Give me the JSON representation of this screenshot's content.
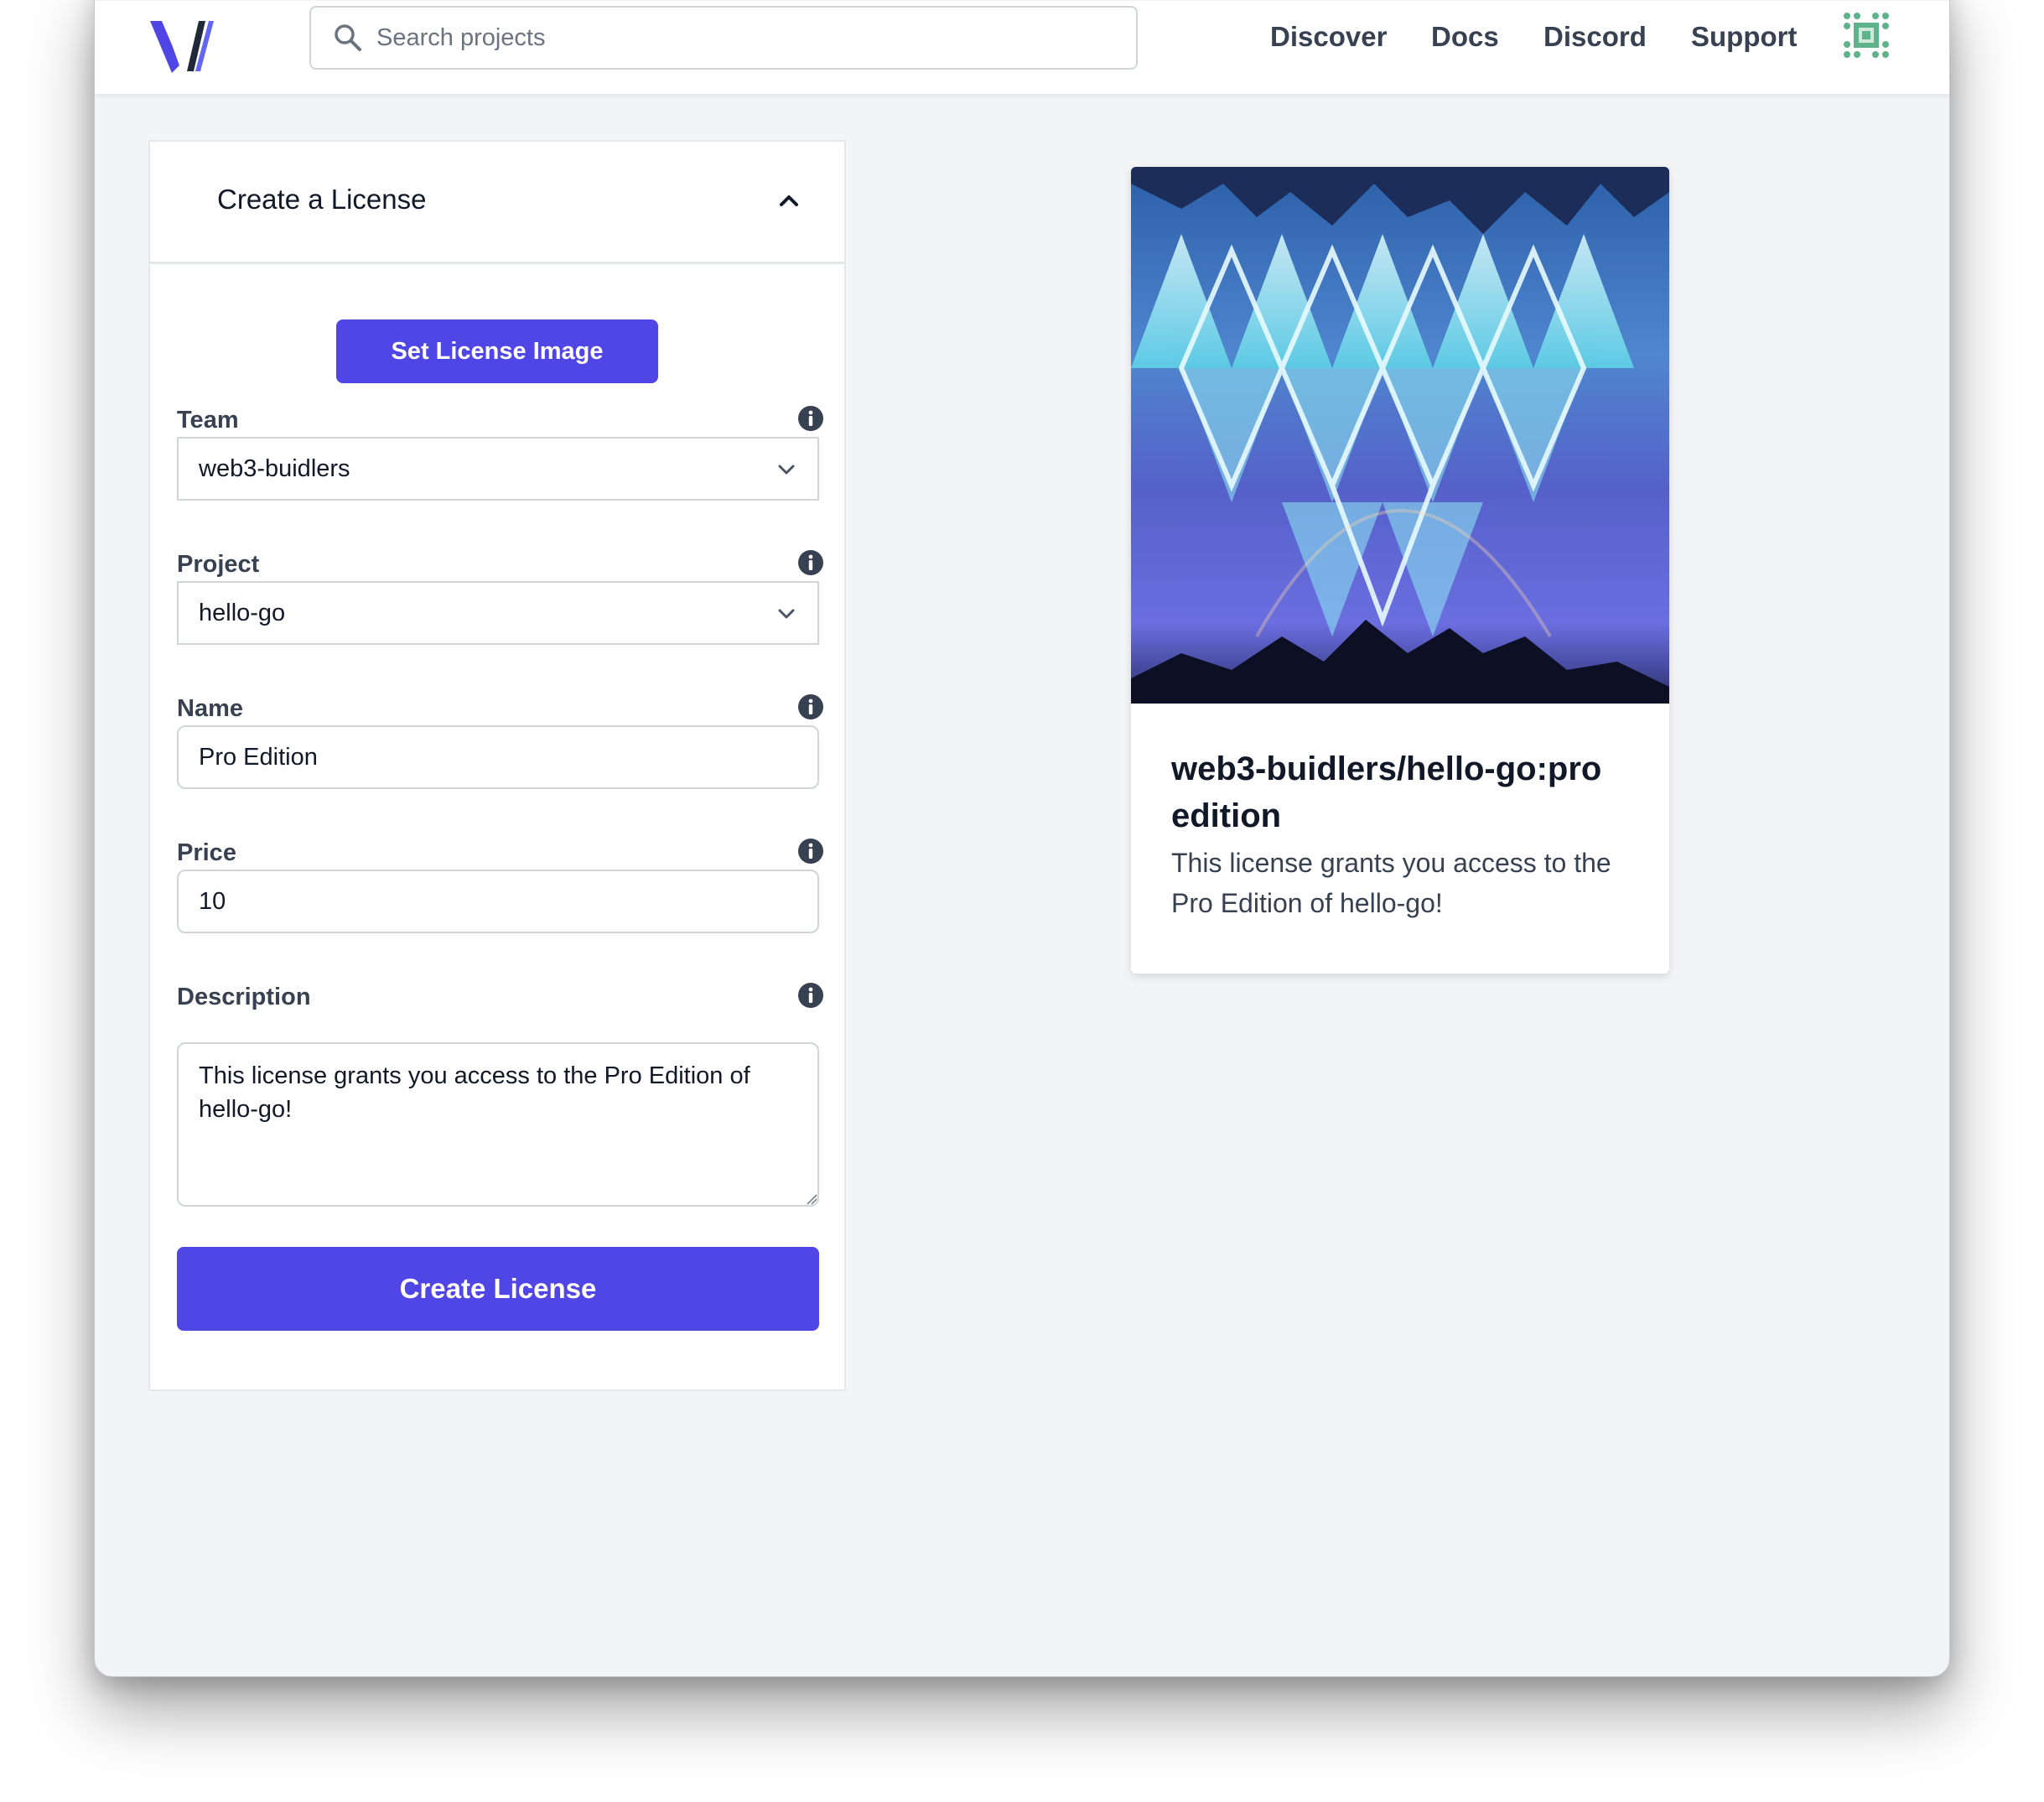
{
  "header": {
    "search_placeholder": "Search projects",
    "nav": [
      "Discover",
      "Docs",
      "Discord",
      "Support"
    ]
  },
  "form": {
    "title": "Create a License",
    "set_image_label": "Set License Image",
    "team": {
      "label": "Team",
      "value": "web3-buidlers"
    },
    "project": {
      "label": "Project",
      "value": "hello-go"
    },
    "name": {
      "label": "Name",
      "value": "Pro Edition"
    },
    "price": {
      "label": "Price",
      "value": "10"
    },
    "description": {
      "label": "Description",
      "value": "This license grants you access to the Pro Edition of hello-go!"
    },
    "submit_label": "Create License"
  },
  "preview": {
    "title": "web3-buidlers/hello-go:pro edition",
    "description": "This license grants you access to the Pro Edition of hello-go!"
  },
  "colors": {
    "accent": "#4f46e5",
    "background": "#f3f4f6",
    "avatar": "#5fb38a"
  },
  "icons": [
    "logo-icon",
    "search-icon",
    "avatar-icon",
    "chevron-up-icon",
    "info-icon",
    "chevron-down-icon"
  ]
}
